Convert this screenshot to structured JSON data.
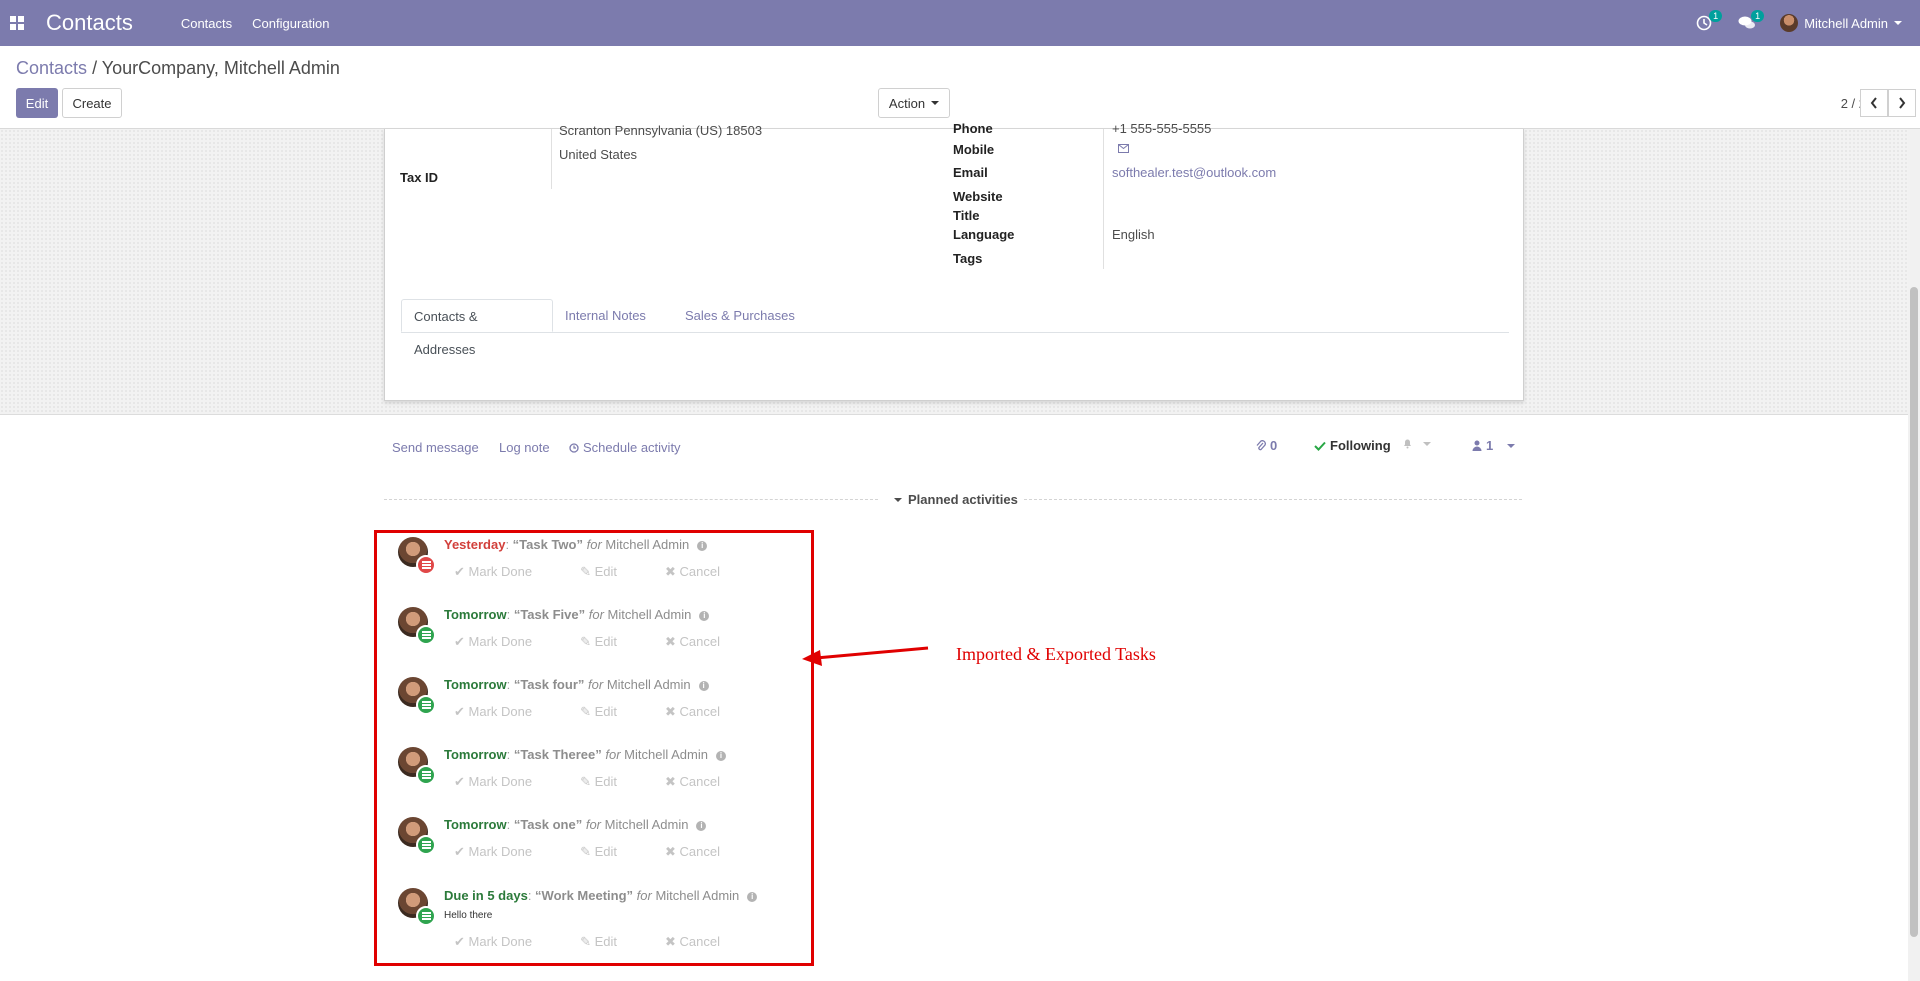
{
  "navbar": {
    "app_title": "Contacts",
    "menu": [
      "Contacts",
      "Configuration"
    ],
    "activity_count": "1",
    "message_count": "1",
    "user_name": "Mitchell Admin"
  },
  "breadcrumb": {
    "parent": "Contacts",
    "separator": "/",
    "current": "YourCompany, Mitchell Admin"
  },
  "toolbar": {
    "edit_label": "Edit",
    "create_label": "Create",
    "action_label": "Action",
    "pager": "2 / 2"
  },
  "form": {
    "address_line": "Scranton  Pennsylvania (US)  18503",
    "country": "United States",
    "tax_id_label": "Tax ID",
    "phone_label": "Phone",
    "phone_value": "+1 555-555-5555",
    "mobile_label": "Mobile",
    "email_label": "Email",
    "email_value": "softhealer.test@outlook.com",
    "website_label": "Website",
    "title_label": "Title",
    "language_label": "Language",
    "language_value": "English",
    "tags_label": "Tags"
  },
  "tabs": [
    "Contacts & Addresses",
    "Internal Notes",
    "Sales & Purchases"
  ],
  "chatter": {
    "send_message": "Send message",
    "log_note": "Log note",
    "schedule_activity": "Schedule activity",
    "attachments_count": "0",
    "following_label": "Following",
    "followers_count": "1",
    "planned_activities": "Planned activities"
  },
  "activities": [
    {
      "when": "Yesterday",
      "summary": "“Task Two”",
      "for": "for",
      "user": "Mitchell Admin",
      "state": "overdue",
      "note": ""
    },
    {
      "when": "Tomorrow",
      "summary": "“Task Five”",
      "for": "for",
      "user": "Mitchell Admin",
      "state": "planned",
      "note": ""
    },
    {
      "when": "Tomorrow",
      "summary": "“Task four”",
      "for": "for",
      "user": "Mitchell Admin",
      "state": "planned",
      "note": ""
    },
    {
      "when": "Tomorrow",
      "summary": "“Task Theree”",
      "for": "for",
      "user": "Mitchell Admin",
      "state": "planned",
      "note": ""
    },
    {
      "when": "Tomorrow",
      "summary": "“Task one”",
      "for": "for",
      "user": "Mitchell Admin",
      "state": "planned",
      "note": ""
    },
    {
      "when": "Due in 5 days",
      "summary": "“Work Meeting”",
      "for": "for",
      "user": "Mitchell Admin",
      "state": "planned",
      "note": "Hello there"
    }
  ],
  "activity_actions": {
    "mark_done": "Mark Done",
    "edit": "Edit",
    "cancel": "Cancel"
  },
  "annotation": {
    "text": "Imported & Exported Tasks",
    "color": "#e00000"
  },
  "colors": {
    "brand": "#7c7bad",
    "overdue": "#d23f3a",
    "planned": "#2b7a3a"
  }
}
